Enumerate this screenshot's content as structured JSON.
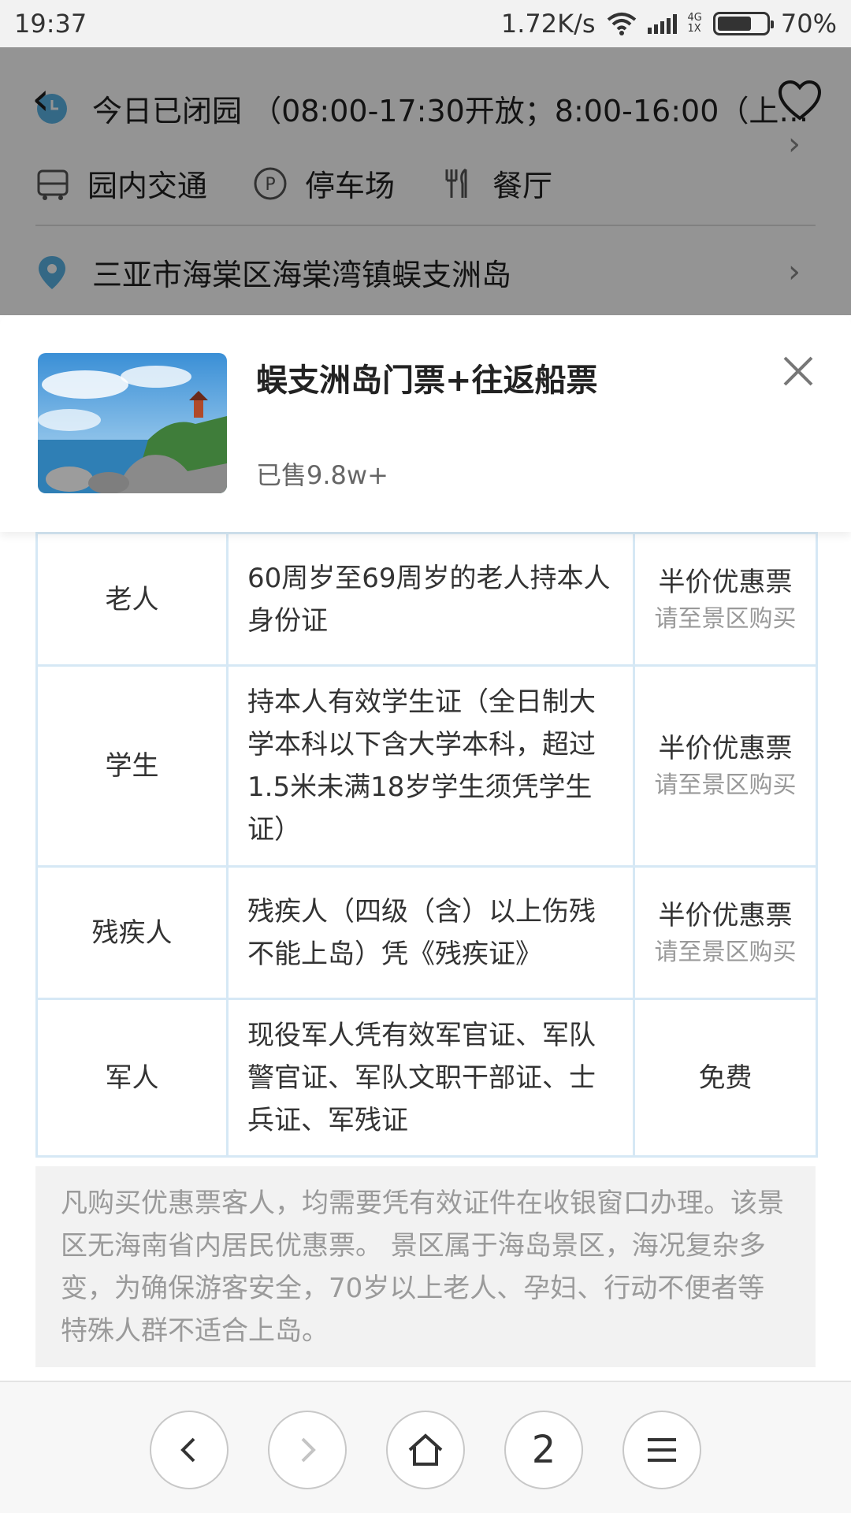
{
  "status_bar": {
    "time": "19:37",
    "net_speed": "1.72K/s",
    "net_tag_top": "4G",
    "net_tag_bottom": "1X",
    "battery": "70%",
    "battery_level": 0.7
  },
  "scenic_info": {
    "hours_text": "今日已闭园 （08:00-17:30开放；8:00-16:00（上…",
    "facilities": [
      {
        "label": "园内交通",
        "icon": "bus-icon"
      },
      {
        "label": "停车场",
        "icon": "parking-icon"
      },
      {
        "label": "餐厅",
        "icon": "restaurant-icon"
      }
    ],
    "address": "三亚市海棠区海棠湾镇蜈支洲岛"
  },
  "product": {
    "title": "蜈支洲岛门票+往返船票",
    "sold": "已售9.8w+",
    "thumbnail": "island-photo"
  },
  "discount_table": {
    "rows": [
      {
        "type": "老人",
        "condition": "60周岁至69周岁的老人持本人身份证",
        "price": "半价优惠票",
        "note": "请至景区购买"
      },
      {
        "type": "学生",
        "condition": "持本人有效学生证（全日制大学本科以下含大学本科，超过1.5米未满18岁学生须凭学生证）",
        "price": "半价优惠票",
        "note": "请至景区购买"
      },
      {
        "type": "残疾人",
        "condition": "残疾人（四级（含）以上伤残不能上岛）凭《残疾证》",
        "price": "半价优惠票",
        "note": "请至景区购买"
      },
      {
        "type": "军人",
        "condition": "现役军人凭有效军官证、军队警官证、军队文职干部证、士兵证、军残证",
        "price": "免费",
        "note": ""
      }
    ]
  },
  "notice": "凡购买优惠票客人，均需要凭有效证件在收银窗口办理。该景区无海南省内居民优惠票。 景区属于海岛景区，海况复杂多变，为确保游客安全，70岁以上老人、孕妇、行动不便者等特殊人群不适合上岛。",
  "bottom_nav": {
    "tab_count": "2"
  },
  "colors": {
    "table_border": "#d6e8f5",
    "notice_bg": "#f2f2f2",
    "overlay": "rgba(0,0,0,0.42)"
  }
}
